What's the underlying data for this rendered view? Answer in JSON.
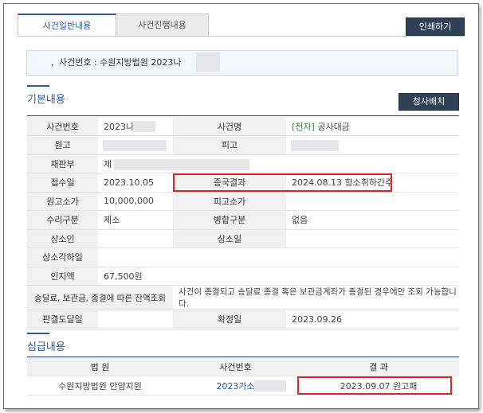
{
  "tabs": [
    {
      "label": "사건일반내용",
      "active": true
    },
    {
      "label": "사건진행내용",
      "active": false
    }
  ],
  "print_button": "인쇄하기",
  "case_banner": "사건번호 : 수원지방법원 2023나",
  "section_basic": "기본내용",
  "judge_button": "청사배치",
  "basic_rows": [
    {
      "l1": "사건번호",
      "v1": "2023나",
      "l2": "사건명",
      "v2_tag": "[전자]",
      "v2": " 공사대금"
    },
    {
      "l1": "원고",
      "v1": "",
      "l2": "피고",
      "v2": ""
    },
    {
      "l1": "재판부",
      "v1": "제",
      "l2": "",
      "v2": ""
    },
    {
      "l1": "접수일",
      "v1": "2023.10.05",
      "l2": "종국결과",
      "v2": "2024.08.13 항소취하간주"
    },
    {
      "l1": "원고소가",
      "v1": "10,000,000",
      "l2": "피고소가",
      "v2": ""
    },
    {
      "l1": "수리구분",
      "v1": "제소",
      "l2": "병합구분",
      "v2": "없음"
    },
    {
      "l1": "상소인",
      "v1": "",
      "l2": "상소일",
      "v2": ""
    },
    {
      "l1": "상소각하일",
      "v1": "",
      "l2": "",
      "v2": ""
    },
    {
      "l1": "인지액",
      "v1": "67,500원",
      "l2": "",
      "v2": ""
    },
    {
      "l1": "송달료, 보관금, 종결에 따른 잔액조회",
      "v_full": "사건이 종결되고 송달료 종결 혹은 보관금계좌가 종결된 경우에만 조회 가능합니다."
    },
    {
      "l1": "판결도달일",
      "v1": "",
      "l2": "확정일",
      "v2": "2023.09.26"
    }
  ],
  "section_grade": "심급내용",
  "grade_headers": [
    "법 원",
    "사건번호",
    "결 과"
  ],
  "grade_rows": [
    {
      "court": "수원지방법원 안양지원",
      "case_no": "2023가소",
      "result": "2023.09.07 원고패"
    }
  ],
  "colors": {
    "accent": "#2a5aa8",
    "dark_button": "#2f4156",
    "highlight": "#d9262b",
    "tag": "#2e8b2e"
  }
}
